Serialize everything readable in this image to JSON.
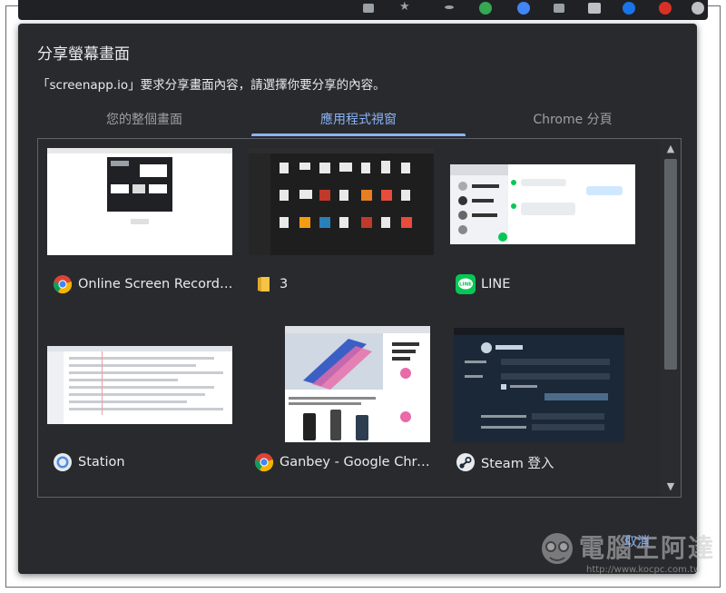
{
  "dialog": {
    "title": "分享螢幕畫面",
    "subtitle": "「screenapp.io」要求分享畫面內容，請選擇你要分享的內容。"
  },
  "tabs": [
    {
      "label": "您的整個畫面",
      "active": false
    },
    {
      "label": "應用程式視窗",
      "active": true
    },
    {
      "label": "Chrome 分頁",
      "active": false
    }
  ],
  "sources": [
    {
      "name": "Online Screen Recorde...",
      "icon": "chrome-icon"
    },
    {
      "name": "3",
      "icon": "folder-icon"
    },
    {
      "name": "LINE",
      "icon": "line-icon"
    },
    {
      "name": "Station",
      "icon": "station-icon"
    },
    {
      "name": "Ganbey - Google Chro...",
      "icon": "chrome-icon"
    },
    {
      "name": "Steam 登入",
      "icon": "steam-icon"
    }
  ],
  "buttons": {
    "cancel": "取消"
  },
  "watermark": {
    "text": "電腦王阿達",
    "url": "http://www.kocpc.com.tw"
  },
  "colors": {
    "dialog_bg": "#292a2d",
    "accent": "#8ab4f8",
    "text": "#e8eaed",
    "muted": "#9aa0a6"
  }
}
